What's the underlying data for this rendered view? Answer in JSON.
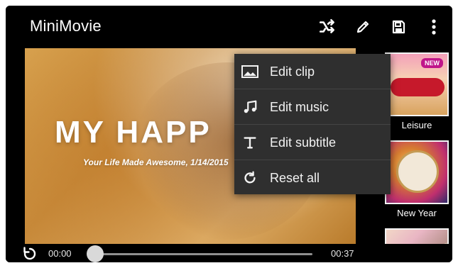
{
  "app": {
    "title": "MiniMovie"
  },
  "toolbar": {
    "icons": [
      "shuffle-icon",
      "pencil-icon",
      "save-icon",
      "more-vert-icon"
    ]
  },
  "preview": {
    "main_title": "MY HAPP",
    "subtitle": "Your Life Made Awesome, 1/14/2015"
  },
  "playback": {
    "current_time": "00:00",
    "total_time": "00:37",
    "progress": 0
  },
  "menu": {
    "items": [
      {
        "label": "Edit clip",
        "icon": "image-icon"
      },
      {
        "label": "Edit music",
        "icon": "music-note-icon"
      },
      {
        "label": "Edit subtitle",
        "icon": "text-t-icon"
      },
      {
        "label": "Reset all",
        "icon": "reset-icon"
      }
    ]
  },
  "themes": [
    {
      "label": "Leisure",
      "badge": "NEW"
    },
    {
      "label": "New Year",
      "badge": ""
    },
    {
      "label": "",
      "badge": ""
    }
  ],
  "colors": {
    "accent": "#c0158a",
    "background": "#000000",
    "menu_bg": "#2f2f2f"
  }
}
